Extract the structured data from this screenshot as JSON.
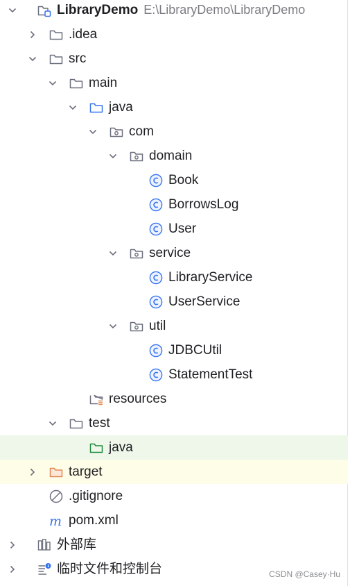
{
  "tree": {
    "project": {
      "name": "LibraryDemo",
      "path": "E:\\LibraryDemo\\LibraryDemo"
    },
    "idea": ".idea",
    "src": "src",
    "main": "main",
    "java_main": "java",
    "com": "com",
    "domain": "domain",
    "book": "Book",
    "borrowslog": "BorrowsLog",
    "user": "User",
    "service": "service",
    "libraryservice": "LibraryService",
    "userservice": "UserService",
    "util": "util",
    "jdbcutil": "JDBCUtil",
    "statementtest": "StatementTest",
    "resources": "resources",
    "test": "test",
    "java_test": "java",
    "target": "target",
    "gitignore": ".gitignore",
    "pom": "pom.xml",
    "external_libs": "外部库",
    "scratches": "临时文件和控制台"
  },
  "watermark": "CSDN @Casey·Hu",
  "colors": {
    "folder": "#6c707e",
    "source_folder": "#3574f0",
    "test_folder": "#208a3c",
    "excluded_folder": "#e08855",
    "class_icon": "#3574f0",
    "selected_row": "#eef7ea",
    "highlight_row": "#fefde7"
  }
}
